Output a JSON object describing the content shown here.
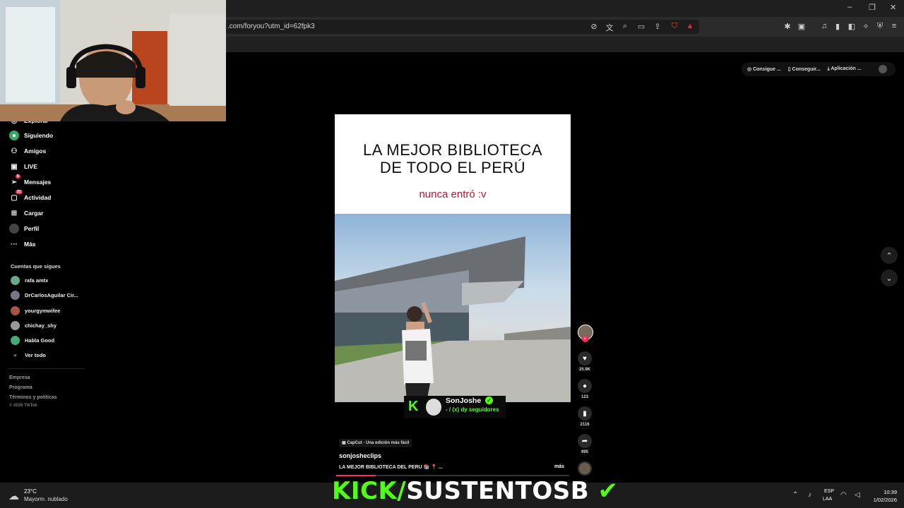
{
  "browser": {
    "url": ".com/foryou?utm_id=62fpk3",
    "window_controls": [
      "–",
      "❐",
      "✕"
    ]
  },
  "top_buttons": [
    "Consigue ...",
    "Conseguir...",
    "Aplicación ..."
  ],
  "sidebar": {
    "items": [
      {
        "label": "Explorar",
        "icon": "compass-icon"
      },
      {
        "label": "Siguiendo",
        "icon": "following-icon"
      },
      {
        "label": "Amigos",
        "icon": "friends-icon"
      },
      {
        "label": "LIVE",
        "icon": "live-icon"
      },
      {
        "label": "Mensajes",
        "icon": "messages-icon",
        "badge": "6"
      },
      {
        "label": "Actividad",
        "icon": "activity-icon",
        "badge": "31"
      },
      {
        "label": "Cargar",
        "icon": "upload-icon"
      },
      {
        "label": "Perfil",
        "icon": "profile-icon"
      },
      {
        "label": "Más",
        "icon": "more-icon"
      }
    ],
    "following_heading": "Cuentas que sigues",
    "following": [
      "rafa amtx",
      "DrCarlosAguilar Cir...",
      "yourgymwifee",
      "chichay_shy",
      "Habla Good"
    ],
    "see_all": "Ver todo",
    "footer": [
      "Empresa",
      "Programa",
      "Términos y políticas",
      "© 2026 TikTok"
    ]
  },
  "video": {
    "title_line1": "LA MEJOR BIBLIOTECA",
    "title_line2": "DE TODO EL PERÚ",
    "subtitle": "nunca entró :v",
    "progress": 0.17
  },
  "kick_overlay": {
    "logo": "K",
    "name": "SonJoshe",
    "followers_line": "- / (x) dy seguidores"
  },
  "actions": {
    "likes": "25.9K",
    "comments": "123",
    "saves": "2116",
    "shares": "995"
  },
  "caption": {
    "capcut": "CapCut · Una edición más fácil",
    "author": "sonjosheclips",
    "description": "LA MEJOR BIBLIOTECA DEL PERU 📚 📍 ...",
    "more": "más"
  },
  "taskbar": {
    "temp": "23°C",
    "weather": "Mayorm. nublado",
    "banner_kick": "KICK/",
    "banner_name": "SUSTENTOSB",
    "lang1": "ESP",
    "lang2": "LAA",
    "time": "10:39",
    "date": "1/02/2026"
  },
  "colors": {
    "accent": "#fe2c55",
    "kick_green": "#53fc18",
    "subtitle_red": "#c8102e"
  }
}
